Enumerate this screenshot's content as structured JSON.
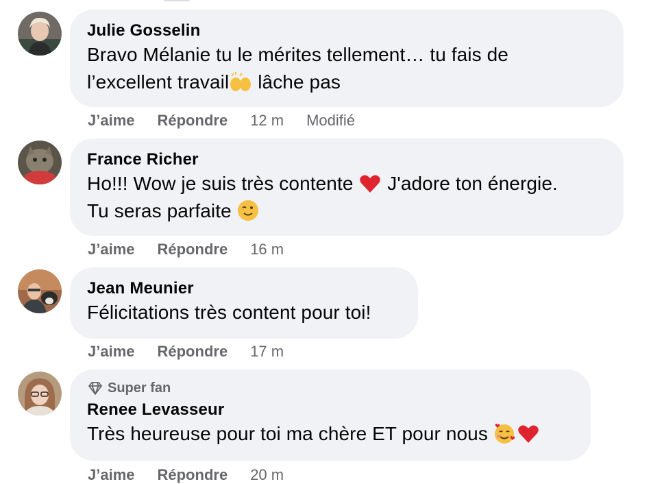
{
  "comments": [
    {
      "author": "Julie Gosselin",
      "line1": "Bravo Mélanie tu le mérites tellement… tu fais de",
      "line2a": "l’excellent travail",
      "line2b": " lâche pas",
      "like": "J’aime",
      "reply": "Répondre",
      "time": "12 m",
      "edited": "Modifié"
    },
    {
      "author": "France Richer",
      "line1a": "Ho!!! Wow je suis très contente ",
      "line1b": " J'adore ton énergie.",
      "line2": "Tu seras parfaite ",
      "like": "J’aime",
      "reply": "Répondre",
      "time": "16 m"
    },
    {
      "author": "Jean Meunier",
      "line1": "Félicitations très content pour toi!",
      "like": "J’aime",
      "reply": "Répondre",
      "time": "17 m"
    },
    {
      "badge": "Super fan",
      "author": "Renee Levasseur",
      "line1": "Très heureuse pour toi ma chère ET pour nous ",
      "like": "J’aime",
      "reply": "Répondre",
      "time": "20 m"
    }
  ],
  "icons": [
    "raising-hands-emoji-icon",
    "red-heart-emoji-icon",
    "winking-face-emoji-icon",
    "smiling-face-with-hearts-emoji-icon",
    "diamond-icon"
  ],
  "colors": {
    "bubble": "#f0f2f5",
    "meta": "#65676b",
    "text": "#050505",
    "heart": "#e0242f"
  }
}
